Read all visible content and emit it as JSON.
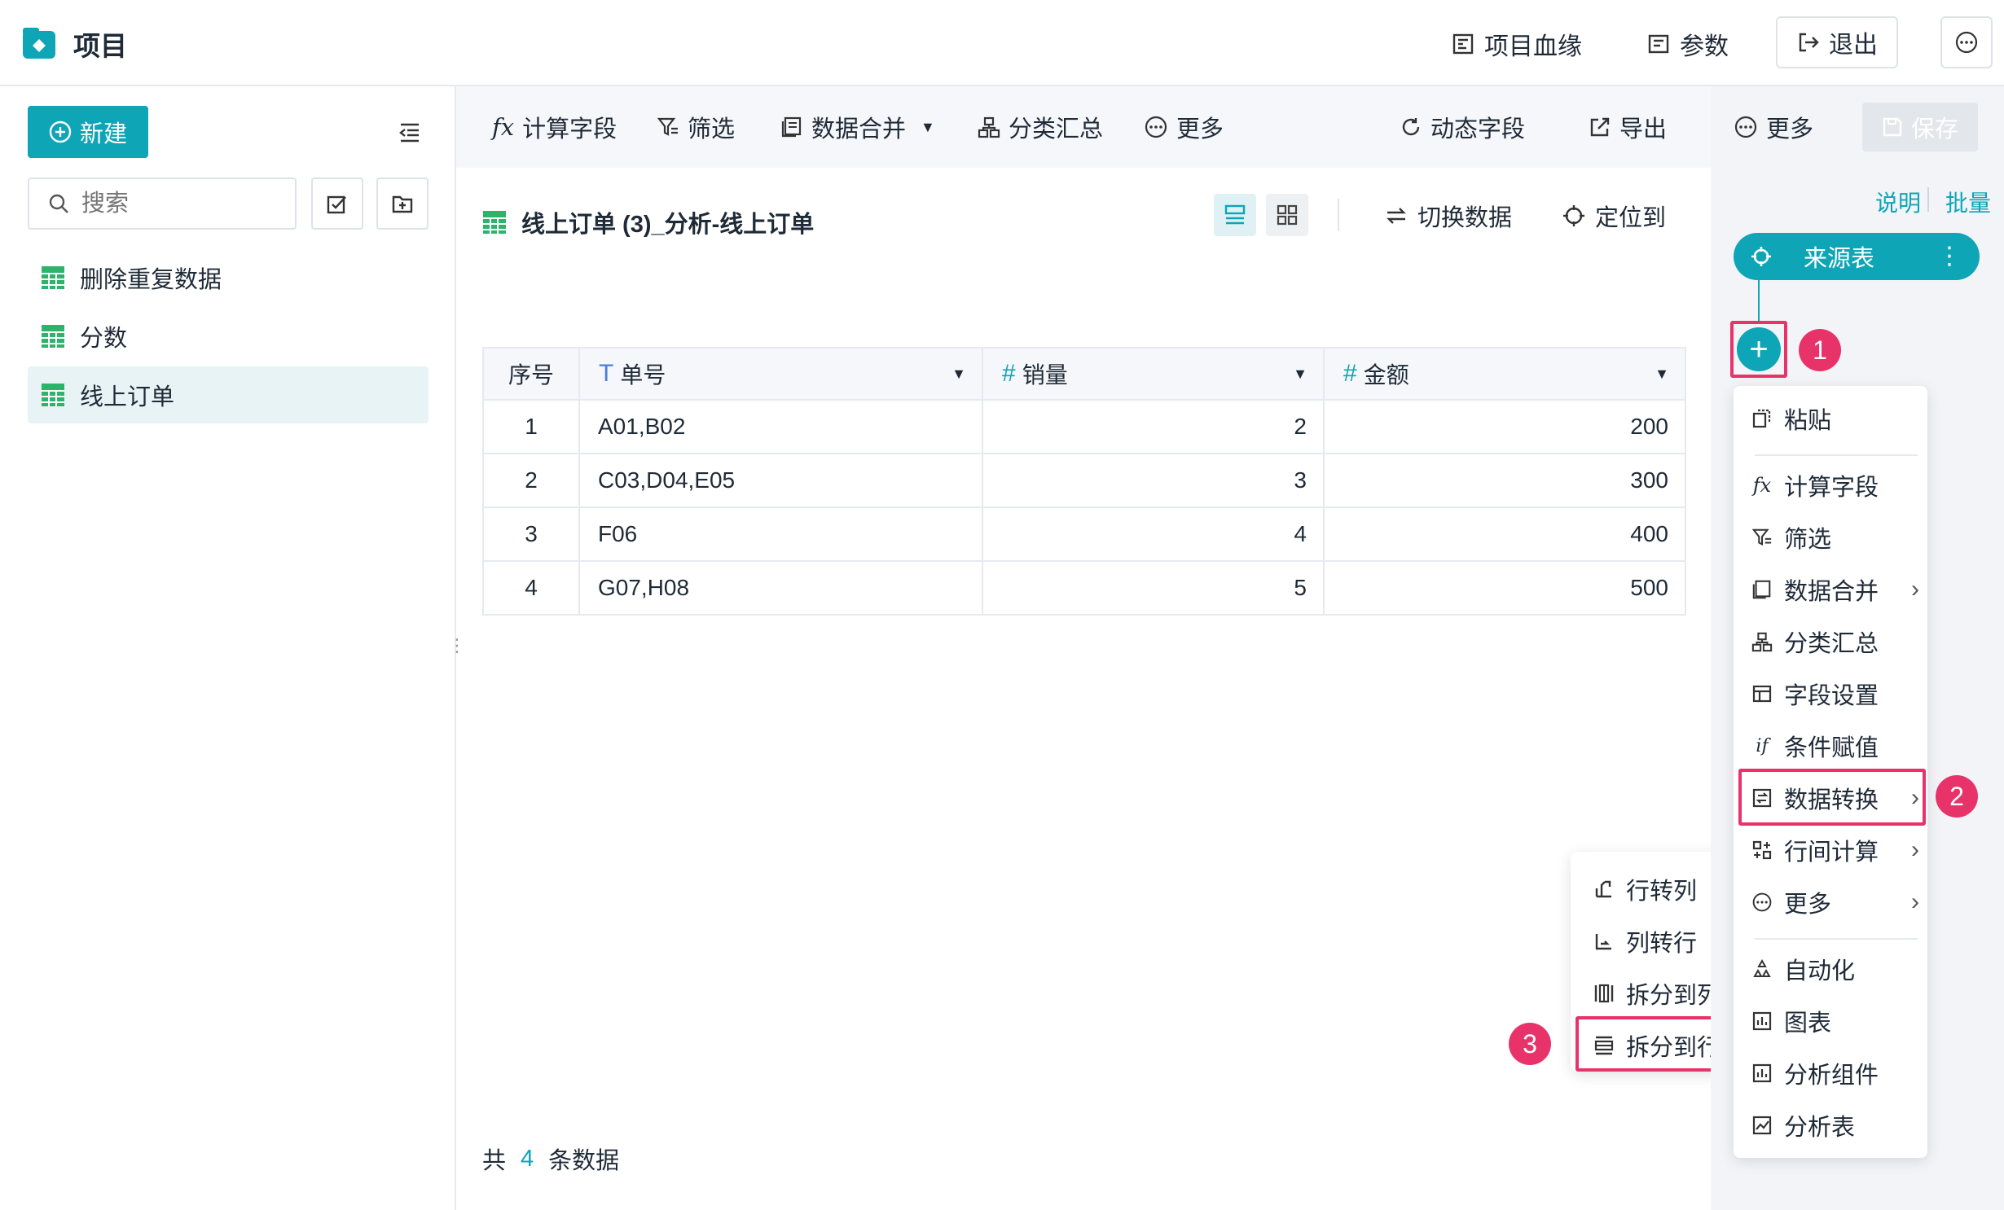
{
  "header": {
    "title": "项目",
    "lineage_label": "项目血缘",
    "params_label": "参数",
    "exit_label": "退出"
  },
  "sidebar": {
    "new_label": "新建",
    "search_placeholder": "搜索",
    "items": [
      {
        "label": "删除重复数据"
      },
      {
        "label": "分数"
      },
      {
        "label": "线上订单"
      }
    ]
  },
  "toolbar": {
    "calc_field": "计算字段",
    "filter": "筛选",
    "merge": "数据合并",
    "group_summary": "分类汇总",
    "more": "更多",
    "dynamic_field": "动态字段",
    "export": "导出",
    "more2": "更多",
    "save": "保存"
  },
  "dataset": {
    "title": "线上订单 (3)_分析-线上订单",
    "switch_data": "切换数据",
    "locate_to": "定位到",
    "columns": [
      {
        "label": "序号"
      },
      {
        "label": "单号",
        "type_icon": "T"
      },
      {
        "label": "销量",
        "type_icon": "#"
      },
      {
        "label": "金额",
        "type_icon": "#"
      }
    ],
    "rows": [
      {
        "idx": "1",
        "order": "A01,B02",
        "qty": "2",
        "amount": "200"
      },
      {
        "idx": "2",
        "order": "C03,D04,E05",
        "qty": "3",
        "amount": "300"
      },
      {
        "idx": "3",
        "order": "F06",
        "qty": "4",
        "amount": "400"
      },
      {
        "idx": "4",
        "order": "G07,H08",
        "qty": "5",
        "amount": "500"
      }
    ],
    "footer_prefix": "共",
    "footer_count": "4",
    "footer_suffix": "条数据"
  },
  "flow": {
    "explain": "说明",
    "batch": "批量",
    "source_node": "来源表"
  },
  "context_menu": {
    "paste": "粘贴",
    "calc_field": "计算字段",
    "filter": "筛选",
    "merge": "数据合并",
    "group_summary": "分类汇总",
    "field_settings": "字段设置",
    "conditional_assign": "条件赋值",
    "data_transform": "数据转换",
    "row_calc": "行间计算",
    "more": "更多",
    "automation": "自动化",
    "chart": "图表",
    "analysis_component": "分析组件",
    "analysis_table": "分析表"
  },
  "submenu": {
    "row_to_col": "行转列",
    "col_to_row": "列转行",
    "split_to_cols": "拆分到列",
    "split_to_rows": "拆分到行"
  },
  "badges": {
    "b1": "1",
    "b2": "2",
    "b3": "3"
  },
  "colors": {
    "accent": "#0ea5b7",
    "highlight": "#e8336a",
    "grid_icon": "#2db36a"
  }
}
